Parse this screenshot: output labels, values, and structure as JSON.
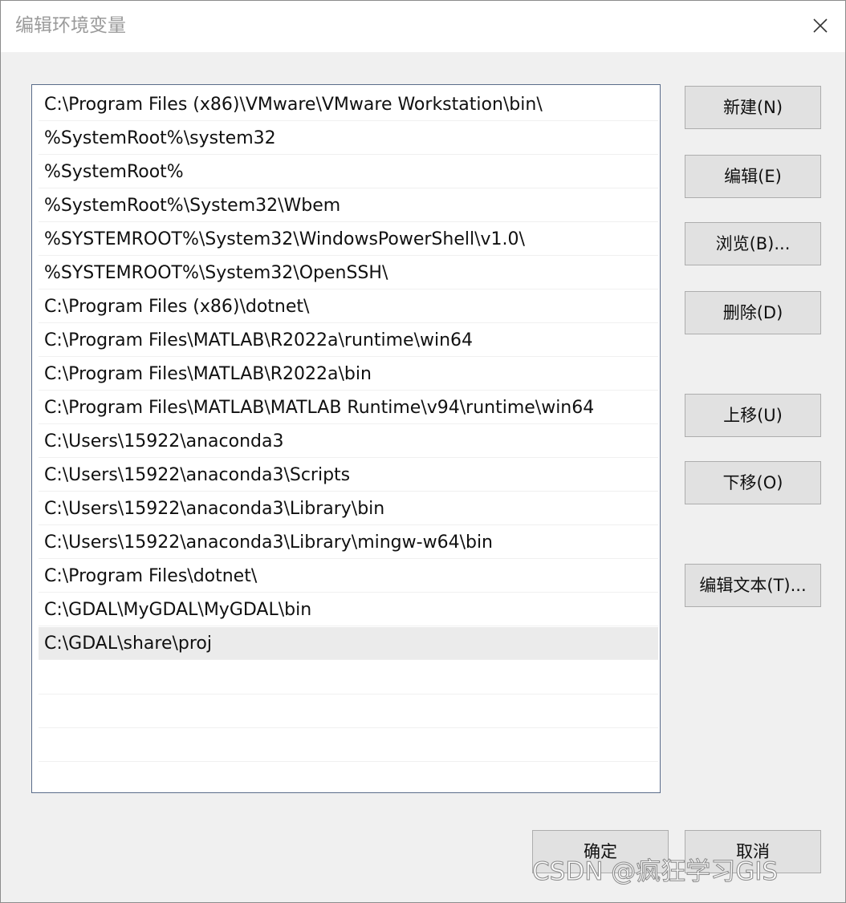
{
  "window": {
    "title": "编辑环境变量",
    "close_icon": "close-icon"
  },
  "path_list": {
    "items": [
      "C:\\Program Files (x86)\\VMware\\VMware Workstation\\bin\\",
      "%SystemRoot%\\system32",
      "%SystemRoot%",
      "%SystemRoot%\\System32\\Wbem",
      "%SYSTEMROOT%\\System32\\WindowsPowerShell\\v1.0\\",
      "%SYSTEMROOT%\\System32\\OpenSSH\\",
      "C:\\Program Files (x86)\\dotnet\\",
      "C:\\Program Files\\MATLAB\\R2022a\\runtime\\win64",
      "C:\\Program Files\\MATLAB\\R2022a\\bin",
      "C:\\Program Files\\MATLAB\\MATLAB Runtime\\v94\\runtime\\win64",
      "C:\\Users\\15922\\anaconda3",
      "C:\\Users\\15922\\anaconda3\\Scripts",
      "C:\\Users\\15922\\anaconda3\\Library\\bin",
      "C:\\Users\\15922\\anaconda3\\Library\\mingw-w64\\bin",
      "C:\\Program Files\\dotnet\\",
      "C:\\GDAL\\MyGDAL\\MyGDAL\\bin",
      "C:\\GDAL\\share\\proj"
    ],
    "selected_index": 16
  },
  "buttons": {
    "new": "新建(N)",
    "edit": "编辑(E)",
    "browse": "浏览(B)...",
    "delete": "删除(D)",
    "move_up": "上移(U)",
    "move_down": "下移(O)",
    "edit_text": "编辑文本(T)...",
    "ok": "确定",
    "cancel": "取消"
  },
  "watermark": "CSDN @疯狂学习GIS"
}
